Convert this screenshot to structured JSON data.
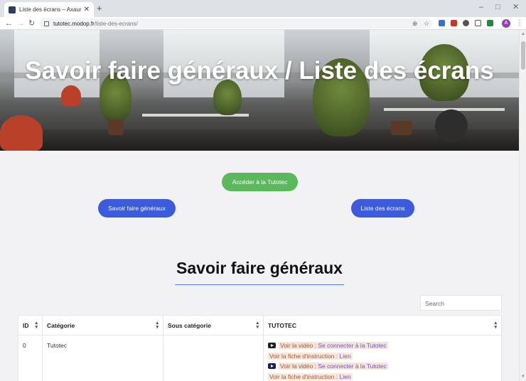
{
  "browser": {
    "tab_title": "Liste des écrans – Axaune Fidelity",
    "tab_close": "✕",
    "new_tab": "+",
    "url_host": "tutotec.modop.fr",
    "url_path": "/liste-des-ecrans/",
    "avatar_letter": "A",
    "icons": [
      "back-icon",
      "forward-icon",
      "reload-icon",
      "lock-icon",
      "zoom-icon",
      "star-icon",
      "menu-icon"
    ]
  },
  "hero": {
    "title": "Savoir faire généraux / Liste des écrans"
  },
  "buttons": {
    "tutotec": "Accéder à la Tutotec",
    "savoir_faire": "Savoir faire généraux",
    "liste_ecrans": "Liste des écrans"
  },
  "section": {
    "title": "Savoir faire généraux"
  },
  "search": {
    "placeholder": "Search"
  },
  "table": {
    "headers": [
      "ID",
      "Catégorie",
      "Sous catégorie",
      "TUTOTEC"
    ],
    "rows": [
      {
        "id": "0",
        "categorie": "Tutotec",
        "sous_categorie": "",
        "tutotec": [
          {
            "type": "video",
            "prefix": "Voir la vidéo : ",
            "link": "Se connecter à la Tutotec"
          },
          {
            "type": "fiche",
            "prefix": "Voir la fiche d'instruction : ",
            "link": "Lien"
          },
          {
            "type": "video",
            "prefix": "Voir la vidéo : ",
            "link": "Se connecter à la Tutotec"
          },
          {
            "type": "fiche",
            "prefix": "Voir la fiche d'instruction : ",
            "link": "Lien"
          }
        ]
      }
    ]
  },
  "colors": {
    "green_button": "#5cb85c",
    "blue_button": "#3b5bdb",
    "divider": "#5a7be0",
    "page_bg": "#f2f2f4"
  }
}
